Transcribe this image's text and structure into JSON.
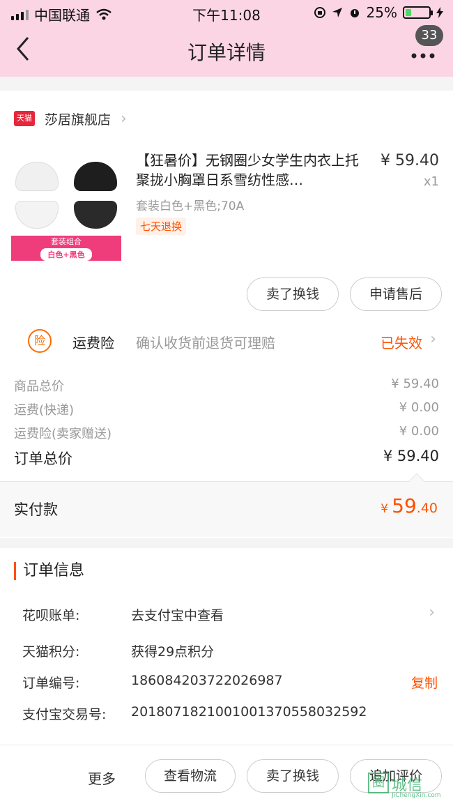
{
  "status_bar": {
    "carrier": "中国联通",
    "time": "下午11:08",
    "battery_percent": "25%",
    "battery_level": 0.25
  },
  "nav": {
    "title": "订单详情",
    "back_icon": "chevron-left-icon",
    "more_icon": "more-dots-icon",
    "badge": "33"
  },
  "shop": {
    "logo_text": "天猫",
    "name": "莎居旗舰店"
  },
  "product": {
    "title": "【狂暑价】无钢圈少女学生内衣上托聚拢小胸罩日系雪纺性感…",
    "price": "¥ 59.40",
    "qty": "x1",
    "sku": "套装白色+黑色;70A",
    "tag": "七天退换",
    "image_banner": "套装组合",
    "image_pill": "白色+黑色"
  },
  "item_actions": {
    "resell": "卖了换钱",
    "after_sale": "申请售后"
  },
  "insurance": {
    "icon_text": "险",
    "name": "运费险",
    "desc": "确认收货前退货可理赔",
    "status": "已失效"
  },
  "fees": [
    {
      "label": "商品总价",
      "value": "¥ 59.40"
    },
    {
      "label": "运费(快递)",
      "value": "¥ 0.00"
    },
    {
      "label": "运费险(卖家赠送)",
      "value": "¥ 0.00"
    }
  ],
  "order_total": {
    "label": "订单总价",
    "value": "¥ 59.40"
  },
  "paid": {
    "label": "实付款",
    "currency": "¥",
    "integer": "59",
    "decimal": ".40"
  },
  "order_info": {
    "heading": "订单信息",
    "rows": [
      {
        "key": "花呗账单:",
        "value": "去支付宝中查看"
      },
      {
        "key": "天猫积分:",
        "value": "获得29点积分"
      },
      {
        "key": "订单编号:",
        "value": "186084203722026987",
        "action": "复制"
      },
      {
        "key": "支付宝交易号:",
        "value": "2018071821001001370558032592"
      }
    ]
  },
  "bottom_bar": {
    "more": "更多",
    "logistics": "查看物流",
    "resell": "卖了换钱",
    "review": "追加评价"
  },
  "watermark": {
    "text": "城信",
    "url": "JiChengXin.com"
  },
  "colors": {
    "header_bg": "#fbd5e4",
    "accent": "#ff5000",
    "tmall_red": "#e5263b"
  }
}
